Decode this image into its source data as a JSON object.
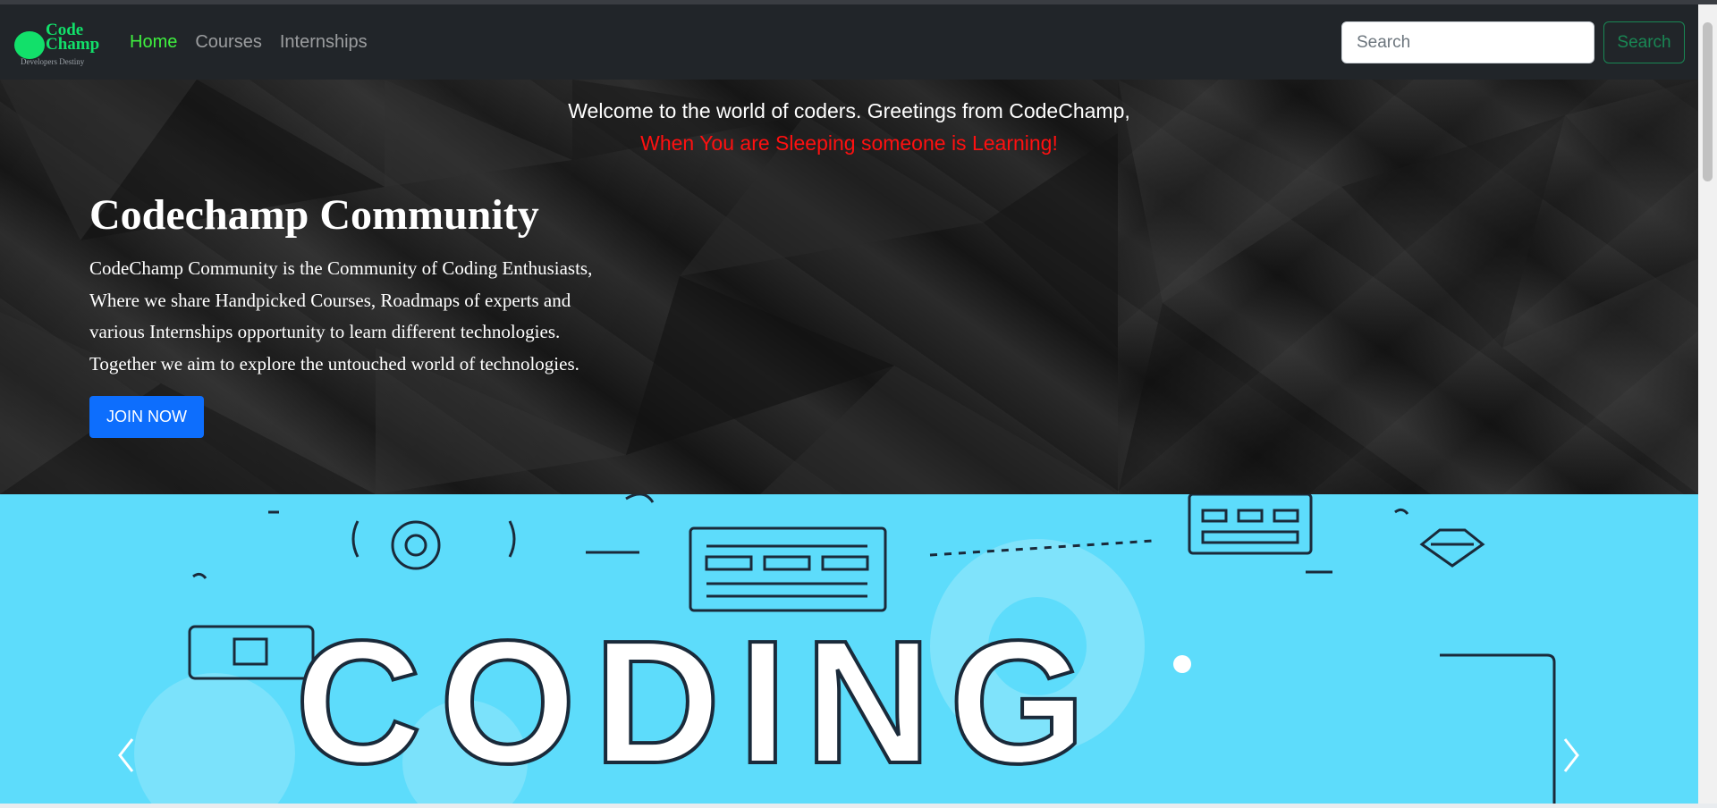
{
  "brand": {
    "name_line1": "Code",
    "name_line2": "Champ",
    "tagline": "Developers Destiny"
  },
  "nav": {
    "items": [
      {
        "label": "Home",
        "active": true
      },
      {
        "label": "Courses",
        "active": false
      },
      {
        "label": "Internships",
        "active": false
      }
    ]
  },
  "search": {
    "placeholder": "Search",
    "button_label": "Search"
  },
  "hero": {
    "welcome": "Welcome to the world of coders. Greetings from CodeChamp,",
    "tagline": "When You are Sleeping someone is Learning!",
    "title": "Codechamp Community",
    "description_lines": [
      "CodeChamp Community is the Community of Coding Enthusiasts,",
      "Where we share Handpicked Courses, Roadmaps of experts and",
      "various Internships opportunity to learn different technologies.",
      "Together we aim to explore the untouched world of technologies."
    ],
    "join_label": "JOIN NOW"
  },
  "carousel": {
    "banner_text": "CODING",
    "prev_icon": "chevron-left-icon",
    "next_icon": "chevron-right-icon"
  },
  "colors": {
    "navbar_bg": "#212529",
    "brand_green": "#12e06a",
    "active_link": "#3ff03f",
    "search_button": "#198754",
    "tagline_red": "#ff1010",
    "join_button": "#0d6efd",
    "carousel_bg": "#5ddcfb"
  }
}
